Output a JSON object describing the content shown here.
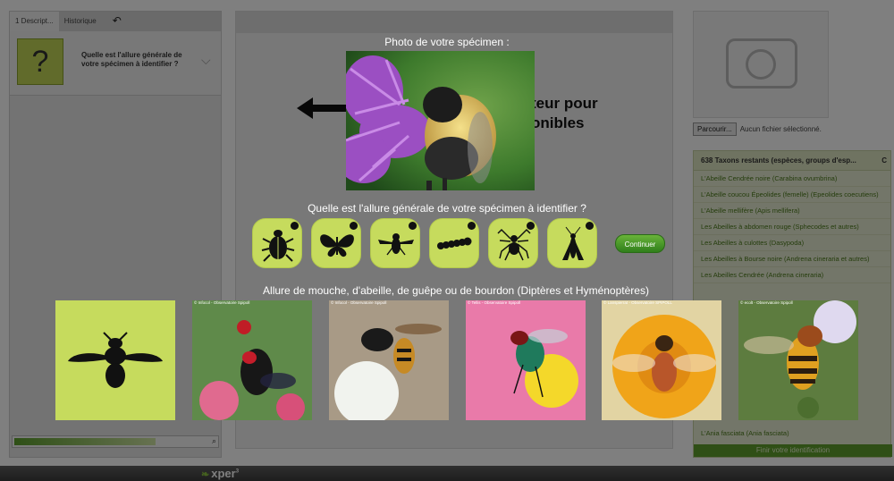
{
  "left_panel": {
    "tab_description": "1 Descript...",
    "tab_history": "Historique",
    "undo_icon": "undo-icon",
    "question_mark": "?",
    "question_short": "Quelle est l'allure générale de votre spécimen à identifier ?"
  },
  "background": {
    "big_text_line1": "teur pour",
    "big_text_line2": "onibles"
  },
  "right_panel": {
    "browse_label": "Parcourir...",
    "no_file_label": "Aucun fichier sélectionné.",
    "taxa_header": "638 Taxons restants (espèces, groups d'esp...",
    "taxa_count": "C",
    "taxa": [
      "L'Abeille Cendrée noire (Carabina ovumbrina)",
      "L'Abeille coucou Épeolides (femelle) (Epeolides coecutiens)",
      "L'Abeille mellifère (Apis mellifera)",
      "Les Abeilles à abdomen rouge (Sphecodes et autres)",
      "Les Abeilles à culottes (Dasypoda)",
      "Les Abeilles à Bourse noire (Andrena cineraria et autres)",
      "Les Abeilles Cendrée (Andrena cineraria)"
    ],
    "taxa_last": "L'Ania fasciata (Ania fasciata)",
    "finish_label": "Finir votre identification"
  },
  "footer": {
    "brand": "xper",
    "brand_sup": "3"
  },
  "overlay": {
    "photo_title": "Photo de votre spécimen :",
    "question": "Quelle est l'allure générale de votre spécimen à identifier ?",
    "shapes": [
      {
        "icon": "beetle-icon",
        "name": "shape-beetle"
      },
      {
        "icon": "butterfly-icon",
        "name": "shape-butterfly"
      },
      {
        "icon": "fly-icon",
        "name": "shape-fly"
      },
      {
        "icon": "caterpillar-icon",
        "name": "shape-caterpillar"
      },
      {
        "icon": "spider-icon",
        "name": "shape-spider"
      },
      {
        "icon": "mosquito-icon",
        "name": "shape-mosquito"
      }
    ],
    "continue_label": "Continuer",
    "allure_title": "Allure de mouche, d'abeille, de guêpe ou de bourdon (Diptères et Hyménoptères)",
    "example_credits": [
      "© Infocol - Observatoire Spipoll",
      "© ecolt - Observatoire Spipoll",
      "© Tellis - Observatoire Spipoll",
      "© Lanspierrat - Observatoire SPIPOLL",
      "© ecolt - Observatoire Spipoll"
    ]
  },
  "colors": {
    "accent_green": "#c6db5d",
    "button_green": "#2f7f1b",
    "overlay_dim": "rgba(0,0,0,0.5)"
  }
}
